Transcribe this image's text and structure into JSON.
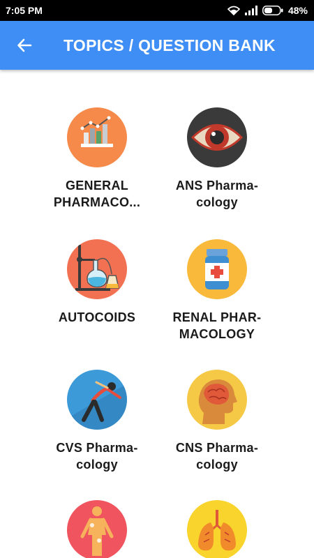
{
  "status_bar": {
    "time": "7:05 PM",
    "battery": "48%"
  },
  "app_bar": {
    "title": "TOPICS / QUESTION BANK",
    "back_icon": "arrow-left-icon"
  },
  "colors": {
    "app_bar": "#3f8ef5",
    "status_bar": "#000000"
  },
  "topics": [
    {
      "label": "GENERAL PHARMACO...",
      "icon": "bar-chart-icon",
      "color": "#f58a4b"
    },
    {
      "label": "ANS Pharma-cology",
      "icon": "eye-icon",
      "color": "#3a3a3a"
    },
    {
      "label": "AUTOCOIDS",
      "icon": "lab-flask-icon",
      "color": "#f27152"
    },
    {
      "label": "RENAL PHAR-MACOLOGY",
      "icon": "medicine-bottle-icon",
      "color": "#f9b93b"
    },
    {
      "label": "CVS Pharma-cology",
      "icon": "stretching-person-icon",
      "color": "#3d9ad8"
    },
    {
      "label": "CNS Pharma-cology",
      "icon": "brain-head-icon",
      "color": "#f5c846"
    },
    {
      "label": "",
      "icon": "human-body-icon",
      "color": "#f0555f"
    },
    {
      "label": "",
      "icon": "lungs-icon",
      "color": "#f9d42c"
    }
  ]
}
